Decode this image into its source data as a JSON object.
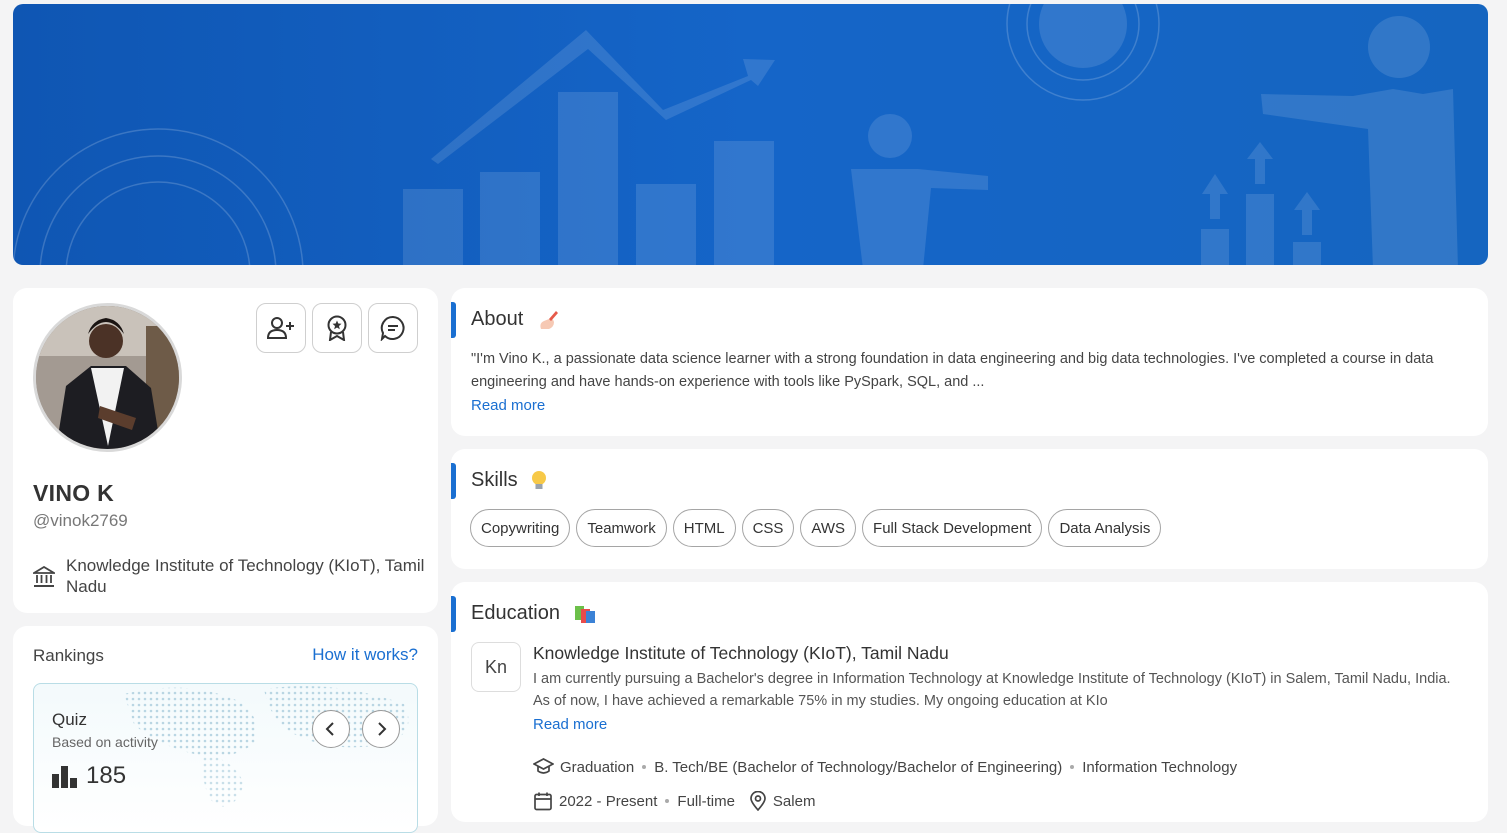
{
  "profile": {
    "name": "VINO K",
    "handle": "@vinok2769",
    "institution": "Knowledge Institute of Technology (KIoT), Tamil Nadu"
  },
  "rankings": {
    "title": "Rankings",
    "link": "How it works?",
    "card": {
      "label": "Quiz",
      "sub": "Based on activity",
      "value": "185"
    }
  },
  "about": {
    "title": "About",
    "text": "\"I'm Vino K., a passionate data science learner with a strong foundation in data engineering and big data technologies. I've completed a course in data engineering and have hands-on experience with tools like PySpark, SQL, and ...",
    "read_more": "Read more"
  },
  "skills": {
    "title": "Skills",
    "items": [
      "Copywriting",
      "Teamwork",
      "HTML",
      "CSS",
      "AWS",
      "Full Stack Development",
      "Data Analysis"
    ]
  },
  "education": {
    "title": "Education",
    "logo_text": "Kn",
    "institution": "Knowledge Institute of Technology (KIoT), Tamil Nadu",
    "description": "I am currently pursuing a Bachelor's degree in Information Technology at Knowledge Institute of Technology (KIoT) in Salem, Tamil Nadu, India. As of now, I have achieved a remarkable 75% in my studies. My ongoing education at KIo",
    "read_more": "Read more",
    "level": "Graduation",
    "degree": "B. Tech/BE (Bachelor of Technology/Bachelor of Engineering)",
    "field": "Information Technology",
    "duration": "2022 - Present",
    "mode": "Full-time",
    "location": "Salem"
  },
  "colors": {
    "accent": "#1a6fd1",
    "banner": "#1565c0"
  }
}
